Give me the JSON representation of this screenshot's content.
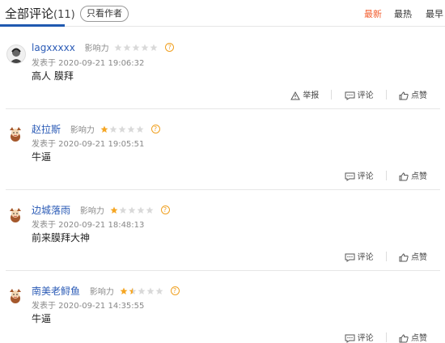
{
  "header": {
    "title": "全部评论",
    "count": "(11)",
    "only_author": "只看作者",
    "sort_new": "最新",
    "sort_hot": "最热",
    "sort_early": "最早"
  },
  "labels": {
    "influence": "影响力",
    "report": "举报",
    "comment": "评论",
    "like": "点赞"
  },
  "comments": [
    {
      "user": "lagxxxxx",
      "rating": 0,
      "time": "发表于 2020-09-21 19:06:32",
      "text": "高人 膜拜",
      "has_report": true
    },
    {
      "user": "赵拉斯",
      "rating": 1,
      "time": "发表于 2020-09-21 19:05:51",
      "text": "牛逼",
      "has_report": false
    },
    {
      "user": "边城落雨",
      "rating": 1,
      "time": "发表于 2020-09-21 18:48:13",
      "text": "前来膜拜大神",
      "has_report": false
    },
    {
      "user": "南美老鲟鱼",
      "rating": 1.5,
      "time": "发表于 2020-09-21 14:35:55",
      "text": "牛逼",
      "has_report": false
    }
  ],
  "colors": {
    "accent": "#f25d2e",
    "link": "#2b5bb6",
    "star": "#f5a623"
  }
}
